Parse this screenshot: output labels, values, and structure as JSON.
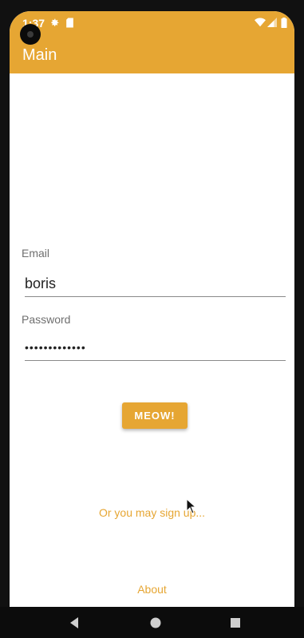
{
  "status_bar": {
    "time": "1:37",
    "icons": [
      "gear-icon",
      "sd-card-icon",
      "wifi-icon",
      "signal-icon",
      "battery-icon"
    ]
  },
  "app_bar": {
    "title": "Main",
    "color": "#E6A633"
  },
  "form": {
    "email_label": "Email",
    "email_value": "boris",
    "password_label": "Password",
    "password_value": "•••••••••••••",
    "submit_label": "MEOW!"
  },
  "links": {
    "signup": "Or you may sign up...",
    "about": "About"
  },
  "nav_bar": {
    "icons": [
      "back-icon",
      "home-icon",
      "recents-icon"
    ]
  }
}
